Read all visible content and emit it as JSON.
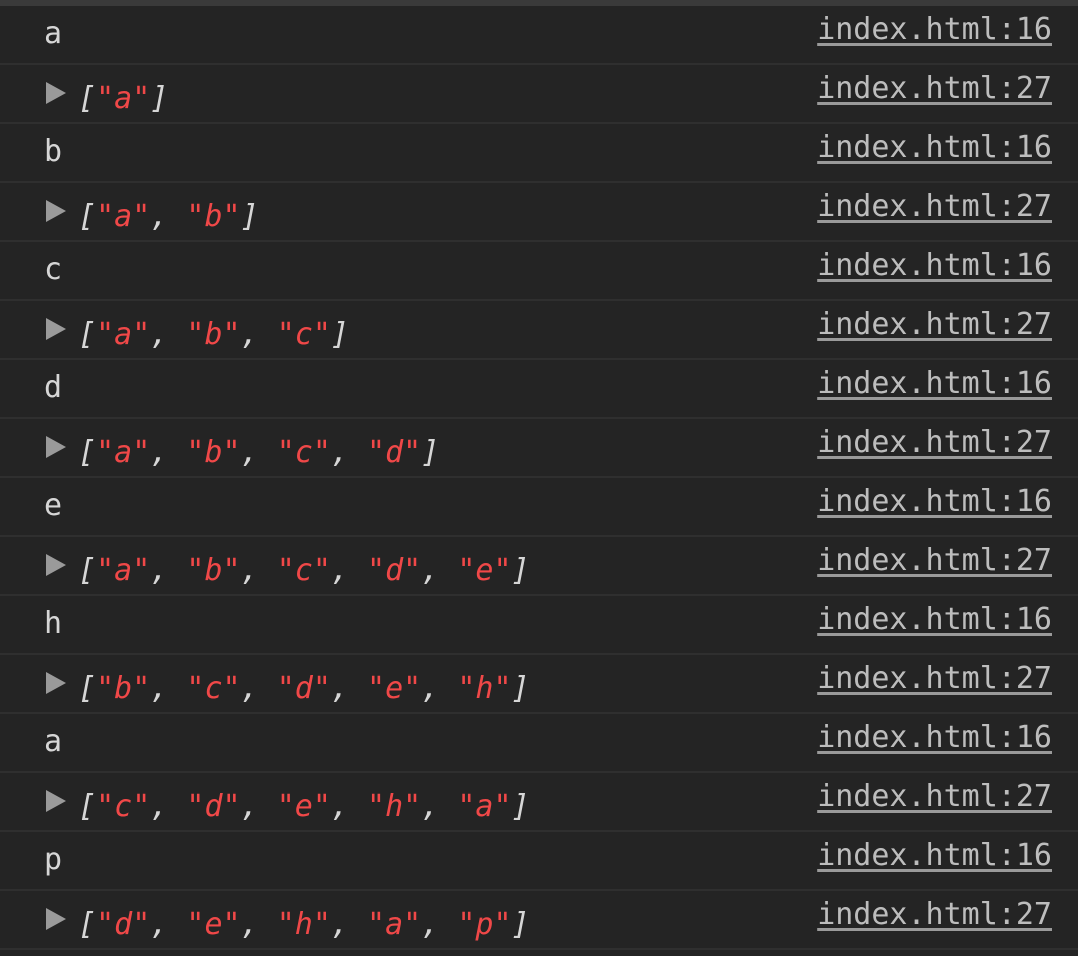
{
  "messages": [
    {
      "kind": "value",
      "text": "a",
      "source": "index.html:16"
    },
    {
      "kind": "array",
      "items": [
        "a"
      ],
      "source": "index.html:27"
    },
    {
      "kind": "value",
      "text": "b",
      "source": "index.html:16"
    },
    {
      "kind": "array",
      "items": [
        "a",
        "b"
      ],
      "source": "index.html:27"
    },
    {
      "kind": "value",
      "text": "c",
      "source": "index.html:16"
    },
    {
      "kind": "array",
      "items": [
        "a",
        "b",
        "c"
      ],
      "source": "index.html:27"
    },
    {
      "kind": "value",
      "text": "d",
      "source": "index.html:16"
    },
    {
      "kind": "array",
      "items": [
        "a",
        "b",
        "c",
        "d"
      ],
      "source": "index.html:27"
    },
    {
      "kind": "value",
      "text": "e",
      "source": "index.html:16"
    },
    {
      "kind": "array",
      "items": [
        "a",
        "b",
        "c",
        "d",
        "e"
      ],
      "source": "index.html:27"
    },
    {
      "kind": "value",
      "text": "h",
      "source": "index.html:16"
    },
    {
      "kind": "array",
      "items": [
        "b",
        "c",
        "d",
        "e",
        "h"
      ],
      "source": "index.html:27"
    },
    {
      "kind": "value",
      "text": "a",
      "source": "index.html:16"
    },
    {
      "kind": "array",
      "items": [
        "c",
        "d",
        "e",
        "h",
        "a"
      ],
      "source": "index.html:27"
    },
    {
      "kind": "value",
      "text": "p",
      "source": "index.html:16"
    },
    {
      "kind": "array",
      "items": [
        "d",
        "e",
        "h",
        "a",
        "p"
      ],
      "source": "index.html:27"
    }
  ],
  "colors": {
    "background": "#242424",
    "string": "#f04848",
    "text": "#d6d6d6",
    "link": "#bdbdbd"
  },
  "icons": {
    "expand": "triangle-right-icon"
  }
}
